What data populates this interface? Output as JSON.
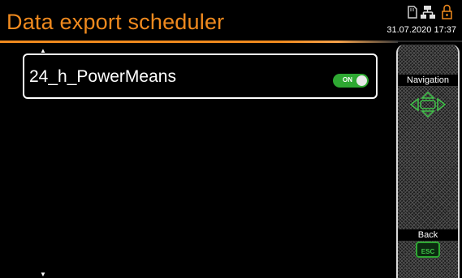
{
  "header": {
    "title": "Data export scheduler",
    "datetime": "31.07.2020 17:37",
    "status_icons": [
      "sd-card-icon",
      "network-icon",
      "lock-icon"
    ]
  },
  "list": {
    "items": [
      {
        "label": "24_h_PowerMeans",
        "toggle": {
          "state_label": "ON",
          "enabled": true
        }
      }
    ]
  },
  "side_panel": {
    "navigation_label": "Navigation",
    "back_label": "Back",
    "esc_label": "ESC"
  },
  "colors": {
    "accent": "#f08a1e",
    "toggle_on": "#2ea832",
    "esc_green": "#3fc448"
  }
}
